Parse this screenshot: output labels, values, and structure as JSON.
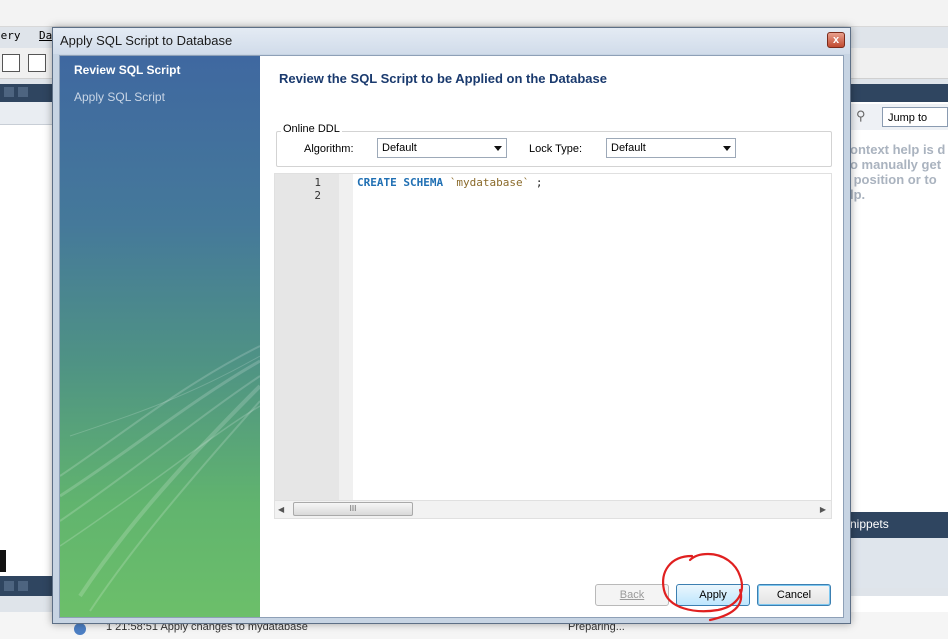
{
  "background": {
    "menu": {
      "query_fragment": "uery",
      "data_fragment": "Da"
    },
    "jump_to": "Jump to",
    "help_text": "ontext help is d\no manually get\n position or to\nlp.",
    "snippets_tab": "nippets",
    "output_row": {
      "time": "1 21:58:51",
      "action": "Apply changes to mydatabase",
      "status": "Preparing..."
    }
  },
  "dialog": {
    "title": "Apply SQL Script to Database",
    "close_symbol": "x",
    "steps": [
      {
        "label": "Review SQL Script",
        "active": true
      },
      {
        "label": "Apply SQL Script",
        "active": false
      }
    ],
    "heading": "Review the SQL Script to be Applied on the Database",
    "online_ddl": {
      "legend": "Online DDL",
      "algorithm_label": "Algorithm:",
      "algorithm_value": "Default",
      "lock_label": "Lock Type:",
      "lock_value": "Default"
    },
    "editor": {
      "line_numbers": [
        "1",
        "2"
      ],
      "code": {
        "keyword": "CREATE SCHEMA",
        "identifier": "`mydatabase`",
        "terminator": ";"
      },
      "scroll_grip": "III"
    },
    "buttons": {
      "back": "Back",
      "apply": "Apply",
      "cancel": "Cancel"
    }
  },
  "colors": {
    "accent_heading": "#1a3a6e",
    "keyword": "#1f6fb3",
    "identifier": "#8a6a2a",
    "annotation": "#e02020"
  },
  "icons": [
    "close-icon",
    "chevron-down-icon",
    "scroll-left-icon",
    "scroll-right-icon",
    "help-icon"
  ]
}
